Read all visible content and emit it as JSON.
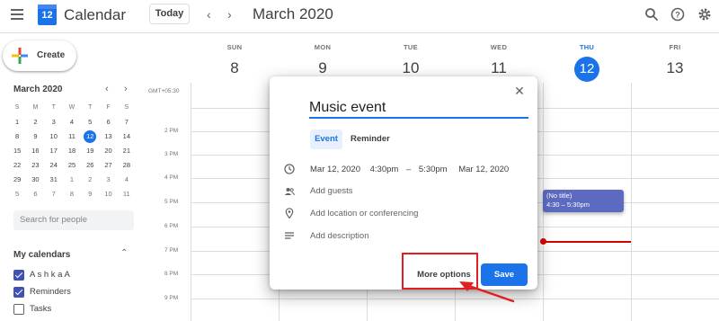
{
  "header": {
    "app_title": "Calendar",
    "logo_day": "12",
    "today_label": "Today",
    "month_title": "March 2020",
    "icons": [
      "menu-icon",
      "chevron-left-icon",
      "chevron-right-icon",
      "search-icon",
      "help-icon",
      "settings-icon"
    ]
  },
  "sidebar": {
    "create_label": "Create",
    "mini_calendar": {
      "title": "March 2020",
      "weekday_headers": [
        "S",
        "M",
        "T",
        "W",
        "T",
        "F",
        "S"
      ],
      "weeks": [
        [
          "1",
          "2",
          "3",
          "4",
          "5",
          "6",
          "7"
        ],
        [
          "8",
          "9",
          "10",
          "11",
          "12",
          "13",
          "14"
        ],
        [
          "15",
          "16",
          "17",
          "18",
          "19",
          "20",
          "21"
        ],
        [
          "22",
          "23",
          "24",
          "25",
          "26",
          "27",
          "28"
        ],
        [
          "29",
          "30",
          "31",
          "1",
          "2",
          "3",
          "4"
        ],
        [
          "5",
          "6",
          "7",
          "8",
          "9",
          "10",
          "11"
        ]
      ],
      "selected": "12"
    },
    "search_people_placeholder": "Search for people",
    "my_calendars": {
      "title": "My calendars",
      "items": [
        {
          "label": "A s h k a A",
          "checked": true,
          "color": "#3f51b5"
        },
        {
          "label": "Reminders",
          "checked": true,
          "color": "#3f51b5"
        },
        {
          "label": "Tasks",
          "checked": false,
          "color": "#5f6368"
        }
      ]
    }
  },
  "week": {
    "timezone": "GMT+05:30",
    "days": [
      {
        "name": "SUN",
        "num": "8",
        "today": false
      },
      {
        "name": "MON",
        "num": "9",
        "today": false
      },
      {
        "name": "TUE",
        "num": "10",
        "today": false
      },
      {
        "name": "WED",
        "num": "11",
        "today": false
      },
      {
        "name": "THU",
        "num": "12",
        "today": true
      },
      {
        "name": "FRI",
        "num": "13",
        "today": false
      }
    ],
    "time_labels": [
      "2 PM",
      "3 PM",
      "4 PM",
      "5 PM",
      "6 PM",
      "7 PM",
      "8 PM",
      "9 PM"
    ],
    "event_chip": {
      "title": "(No title)",
      "time": "4:30 – 5:30pm",
      "color": "#5c6bc0"
    }
  },
  "dialog": {
    "title_value": "Music event",
    "tab_event": "Event",
    "tab_reminder": "Reminder",
    "start_date": "Mar 12, 2020",
    "start_time": "4:30pm",
    "dash": "–",
    "end_time": "5:30pm",
    "end_date": "Mar 12, 2020",
    "add_guests": "Add guests",
    "add_location": "Add location or conferencing",
    "add_description": "Add description",
    "more_options": "More options",
    "save": "Save"
  },
  "colors": {
    "accent": "#1a73e8",
    "annotation": "#e02020",
    "now_line": "#d50000"
  }
}
